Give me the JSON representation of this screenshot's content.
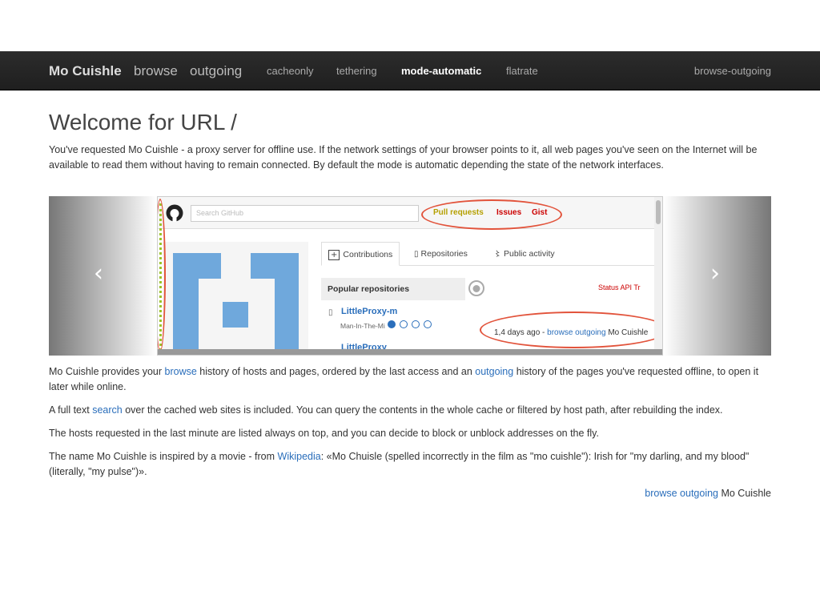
{
  "navbar": {
    "brand": "Mo Cuishle",
    "browse": "browse",
    "outgoing": "outgoing",
    "cacheonly": "cacheonly",
    "tethering": "tethering",
    "mode_automatic": "mode-automatic",
    "flatrate": "flatrate",
    "browse_outgoing": "browse-outgoing"
  },
  "page": {
    "title": "Welcome for URL /",
    "intro": "You've requested Mo Cuishle - a proxy server for offline use. If the network settings of your browser points to it, all web pages you've seen on the Internet will be available to read them without having to remain connected. By default the mode is automatic depending the state of the network interfaces.",
    "p1_a": "Mo Cuishle provides your ",
    "p1_link1": "browse",
    "p1_b": " history of hosts and pages, ordered by the last access and an ",
    "p1_link2": "outgoing",
    "p1_c": " history of the pages you've requested offline, to open it later while online.",
    "p2_a": "A full text ",
    "p2_link": "search",
    "p2_b": " over the cached web sites is included. You can query the contents in the whole cache or filtered by host path, after rebuilding the index.",
    "p3": "The hosts requested in the last minute are listed always on top, and you can decide to block or unblock addresses on the fly.",
    "p4_a": "The name Mo Cuishle is inspired by a movie - from ",
    "p4_link": "Wikipedia",
    "p4_b": ": «Mo Chuisle (spelled incorrectly in the film as \"mo cuishle\"): Irish for \"my darling, and my blood\" (literally, \"my pulse\")».",
    "footer_link": "browse outgoing",
    "footer_text": " Mo Cuishle"
  },
  "carousel": {
    "prev_label": "‹",
    "next_label": "›",
    "indicator_count": 4,
    "active_indicator": 0,
    "slide": {
      "search_placeholder": "Search GitHub",
      "pull_requests": "Pull requests",
      "issues": "Issues",
      "gist": "Gist",
      "tab_contributions": "Contributions",
      "tab_repositories": "Repositories",
      "tab_public_activity": "Public activity",
      "popular_repositories": "Popular repositories",
      "repo1": "LittleProxy-m",
      "repo1_sub": "Man-In-The-Mi",
      "repo2": "LittleProxy",
      "links": "Status   API   Tr",
      "stamp_text": "1,4 days ago - ",
      "stamp_link": "browse outgoing",
      "stamp_tail": " Mo Cuishle"
    }
  },
  "colors": {
    "navbar_bg": "#222222",
    "link": "#2a6ebb",
    "highlight_red": "#e2533b",
    "highlight_green": "#9bc32a"
  }
}
